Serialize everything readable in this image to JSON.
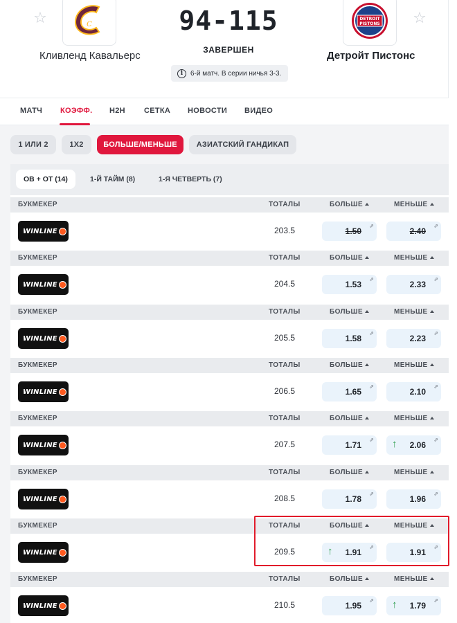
{
  "header": {
    "home_team": "Кливленд Кавальерс",
    "away_team": "Детройт Пистонс",
    "score": "94-115",
    "status": "ЗАВЕРШЕН",
    "series_info": "6-й матч. В серии ничья 3-3.",
    "info_icon": "i",
    "star_icon": "☆",
    "home_logo_letter": "C",
    "away_logo_text_1": "DETROIT",
    "away_logo_text_2": "PISTONS"
  },
  "tabs": [
    "МАТЧ",
    "КОЭФФ.",
    "H2H",
    "СЕТКА",
    "НОВОСТИ",
    "ВИДЕО"
  ],
  "bet_types": [
    "1 ИЛИ 2",
    "1X2",
    "БОЛЬШЕ/МЕНЬШЕ",
    "АЗИАТСКИЙ ГАНДИКАП"
  ],
  "periods": [
    "ОВ + ОТ (14)",
    "1-Й ТАЙМ (8)",
    "1-Я ЧЕТВЕРТЬ (7)"
  ],
  "columns": {
    "bookmaker": "БУКМЕКЕР",
    "totals": "ТОТАЛЫ",
    "over": "БОЛЬШЕ",
    "under": "МЕНЬШЕ"
  },
  "bookmaker": {
    "name": "WINLINE"
  },
  "rows": [
    {
      "total": "203.5",
      "over": "1.50",
      "under": "2.40",
      "over_trend": "",
      "under_trend": "",
      "struck": true
    },
    {
      "total": "204.5",
      "over": "1.53",
      "under": "2.33",
      "over_trend": "",
      "under_trend": "",
      "struck": false
    },
    {
      "total": "205.5",
      "over": "1.58",
      "under": "2.23",
      "over_trend": "",
      "under_trend": "",
      "struck": false
    },
    {
      "total": "206.5",
      "over": "1.65",
      "under": "2.10",
      "over_trend": "",
      "under_trend": "",
      "struck": false
    },
    {
      "total": "207.5",
      "over": "1.71",
      "under": "2.06",
      "over_trend": "",
      "under_trend": "up",
      "struck": false
    },
    {
      "total": "208.5",
      "over": "1.78",
      "under": "1.96",
      "over_trend": "",
      "under_trend": "",
      "struck": false
    },
    {
      "total": "209.5",
      "over": "1.91",
      "under": "1.91",
      "over_trend": "up",
      "under_trend": "",
      "struck": false
    },
    {
      "total": "210.5",
      "over": "1.95",
      "under": "1.79",
      "over_trend": "",
      "under_trend": "up",
      "struck": false
    }
  ],
  "icons": {
    "up_arrow": "↑",
    "external_link": "⇗"
  },
  "colors": {
    "accent": "#e0173d",
    "odd_bg": "#eaf3fb",
    "trend_up": "#2e9e4f",
    "highlight": "#e11a2a"
  },
  "highlighted_row_index": 6
}
